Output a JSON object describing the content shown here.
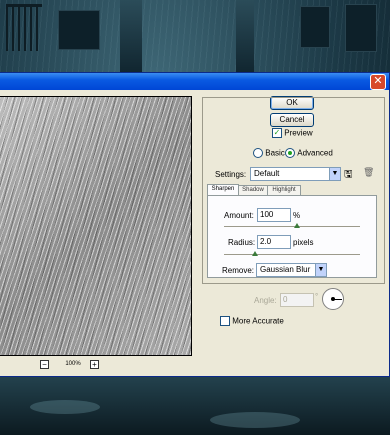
{
  "dialog": {
    "close_glyph": "✕",
    "preview": {
      "zoom_out": "−",
      "zoom_level": "100%",
      "zoom_in": "+"
    },
    "buttons": {
      "ok": "OK",
      "cancel": "Cancel"
    },
    "preview_check": {
      "label": "Preview",
      "checked": true
    },
    "mode": {
      "basic_label": "Basic",
      "advanced_label": "Advanced",
      "selected": "Advanced"
    },
    "settings": {
      "label": "Settings:",
      "value": "Default",
      "save_icon": "floppy-save-icon",
      "delete_icon": "trash-icon"
    },
    "tabs": [
      "Sharpen",
      "Shadow",
      "Highlight"
    ],
    "sharpen": {
      "amount_label": "Amount:",
      "amount_value": "100",
      "amount_unit": "%",
      "radius_label": "Radius:",
      "radius_value": "2.0",
      "radius_unit": "pixels",
      "remove_label": "Remove:",
      "remove_value": "Gaussian Blur",
      "angle_label": "Angle:",
      "angle_value": "0",
      "angle_unit": "°",
      "more_accurate_label": "More Accurate"
    }
  }
}
